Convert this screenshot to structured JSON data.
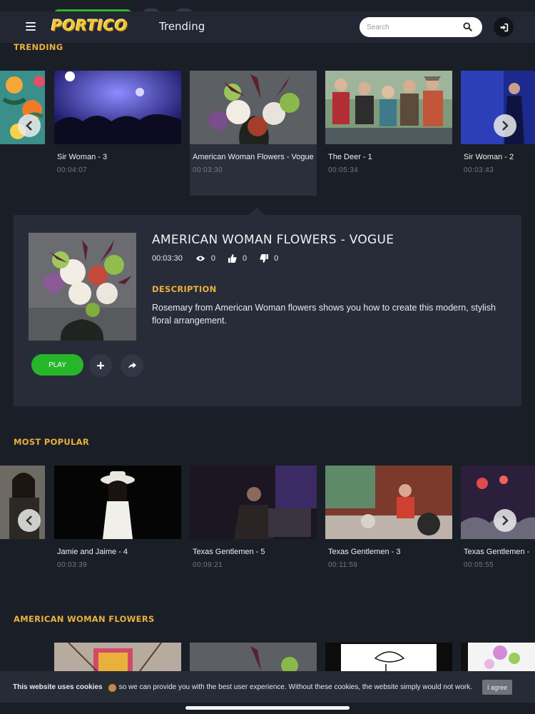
{
  "header": {
    "logo": "PORTICO",
    "page_title": "Trending",
    "search_placeholder": "Search"
  },
  "sections": {
    "trending": "TRENDING",
    "most_popular": "MOST POPULAR",
    "american_woman_flowers": "AMERICAN WOMAN FLOWERS"
  },
  "trending": [
    {
      "title": "Sir Woman - 3",
      "duration": "00:04:07"
    },
    {
      "title": "American Woman Flowers - Vogue",
      "duration": "00:03:30"
    },
    {
      "title": "The Deer - 1",
      "duration": "00:05:34"
    },
    {
      "title": "Sir Woman - 2",
      "duration": "00:03:43"
    }
  ],
  "detail": {
    "title": "AMERICAN WOMAN FLOWERS - VOGUE",
    "duration": "00:03:30",
    "views": "0",
    "likes": "0",
    "dislikes": "0",
    "description_heading": "DESCRIPTION",
    "description": "Rosemary from American Woman flowers shows you how to create this modern, stylish floral arrangement.",
    "play_label": "PLAY"
  },
  "most_popular": [
    {
      "title": "Jamie and Jaime - 4",
      "duration": "00:03:39"
    },
    {
      "title": "Texas Gentlemen - 5",
      "duration": "00:09:21"
    },
    {
      "title": "Texas Gentlemen - 3",
      "duration": "00:11:59"
    },
    {
      "title": "Texas Gentlemen -",
      "duration": "00:05:55"
    }
  ],
  "cookie": {
    "bold": "This website uses cookies",
    "text": "so we can provide you with the best user experience. Without these cookies, the website simply would not work.",
    "agree_label": "I agree"
  },
  "colors": {
    "accent": "#e9b13c",
    "play": "#27b52a",
    "background": "#1a1e27"
  }
}
